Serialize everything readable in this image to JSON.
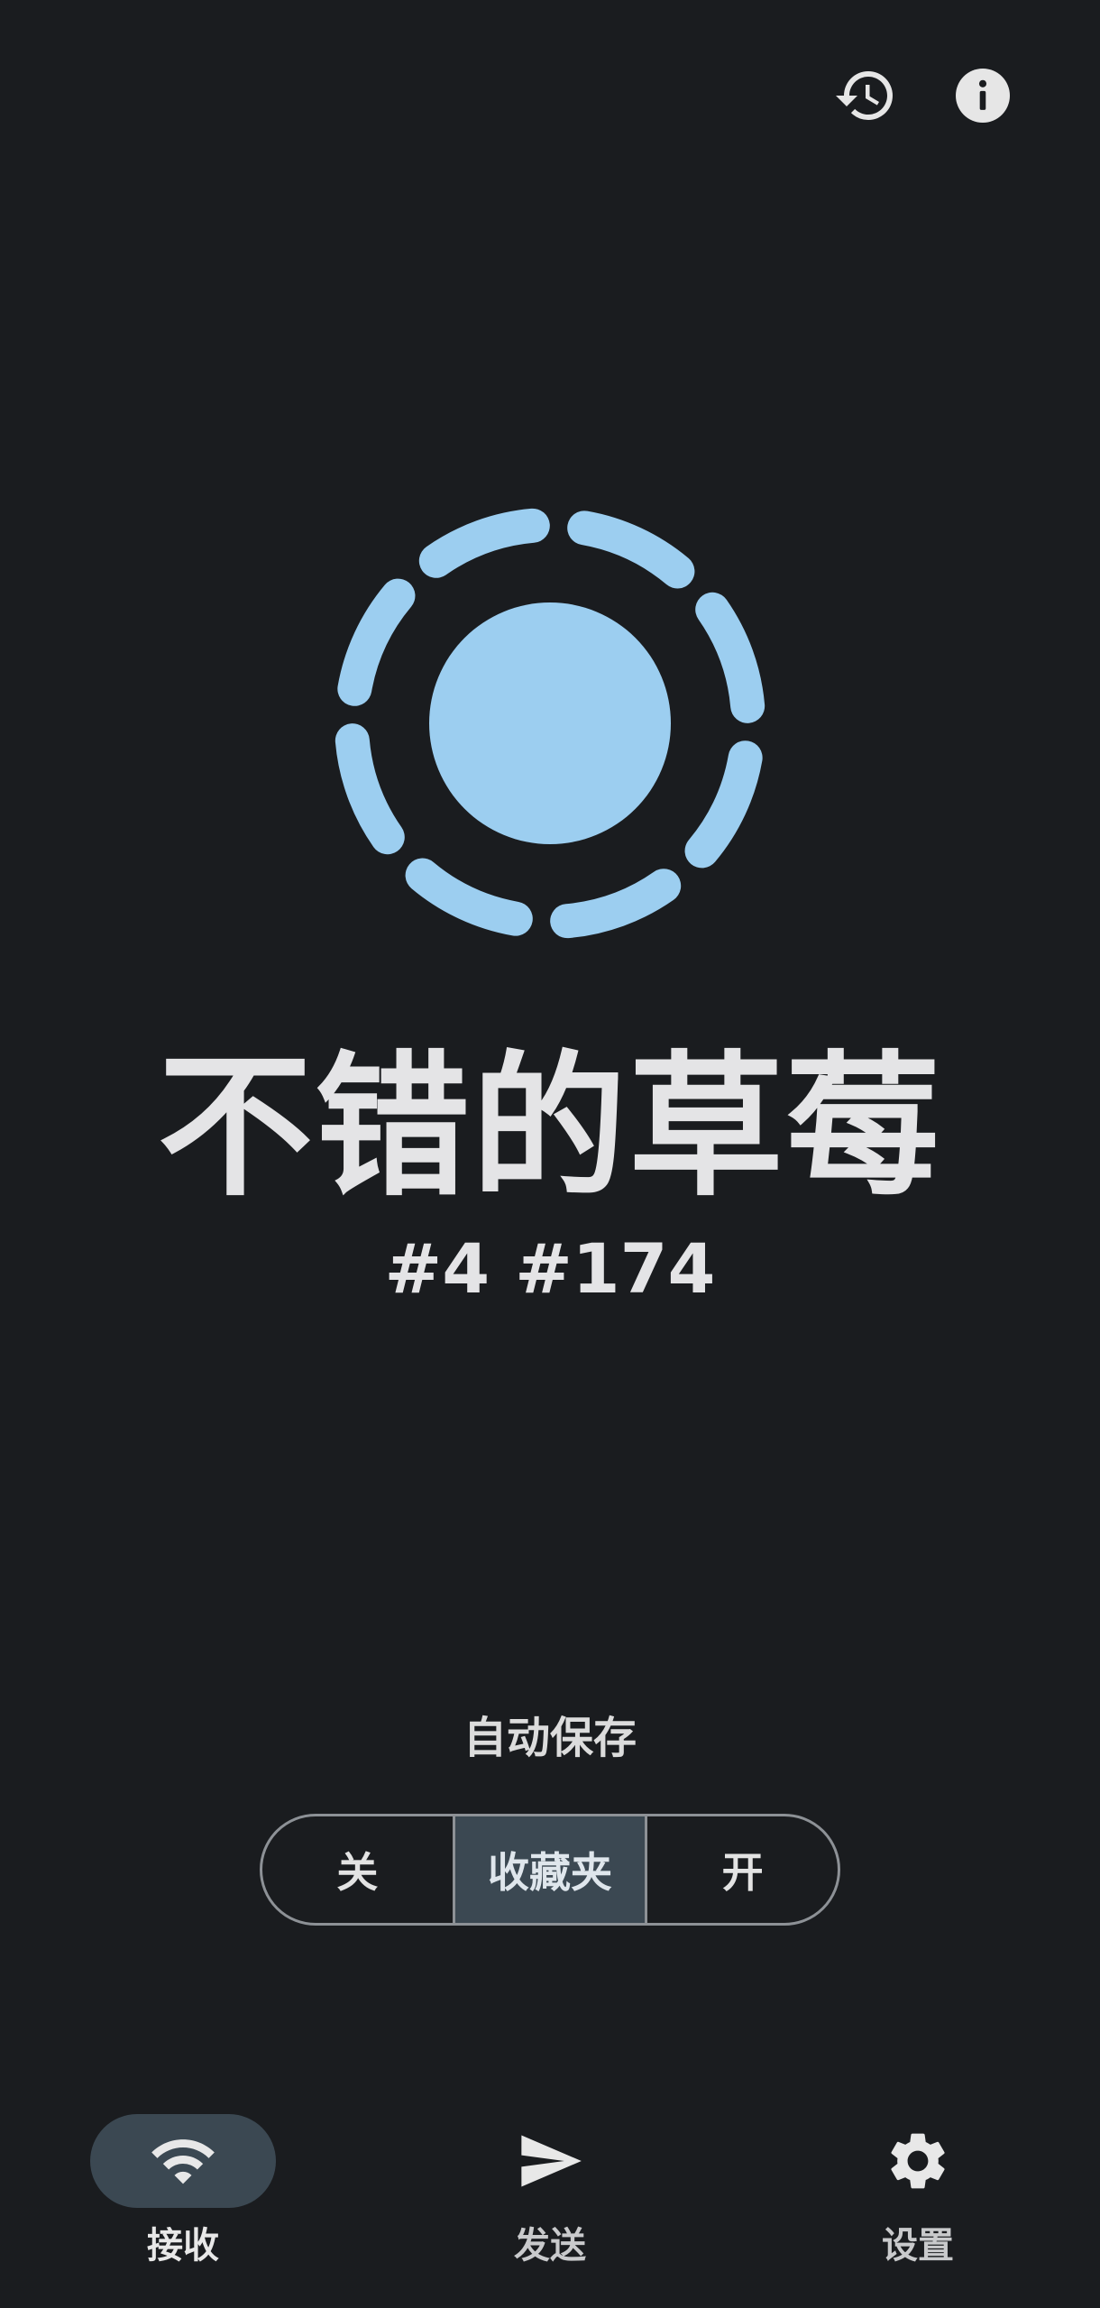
{
  "colors": {
    "background": "#1a1c1f",
    "accent": "#9ccef0",
    "selected_surface": "#3b4852",
    "text": "#e4e4e6"
  },
  "header": {
    "history_icon": "history-icon",
    "info_icon": "info-icon"
  },
  "device": {
    "name": "不错的草莓",
    "tag_1": "#4",
    "tag_2": "#174"
  },
  "autosave": {
    "label": "自动保存",
    "options": [
      "关",
      "收藏夹",
      "开"
    ],
    "selected": "收藏夹"
  },
  "nav": {
    "items": [
      {
        "label": "接收",
        "icon": "wifi-icon",
        "active": true
      },
      {
        "label": "发送",
        "icon": "send-icon",
        "active": false
      },
      {
        "label": "设置",
        "icon": "gear-icon",
        "active": false
      }
    ]
  }
}
